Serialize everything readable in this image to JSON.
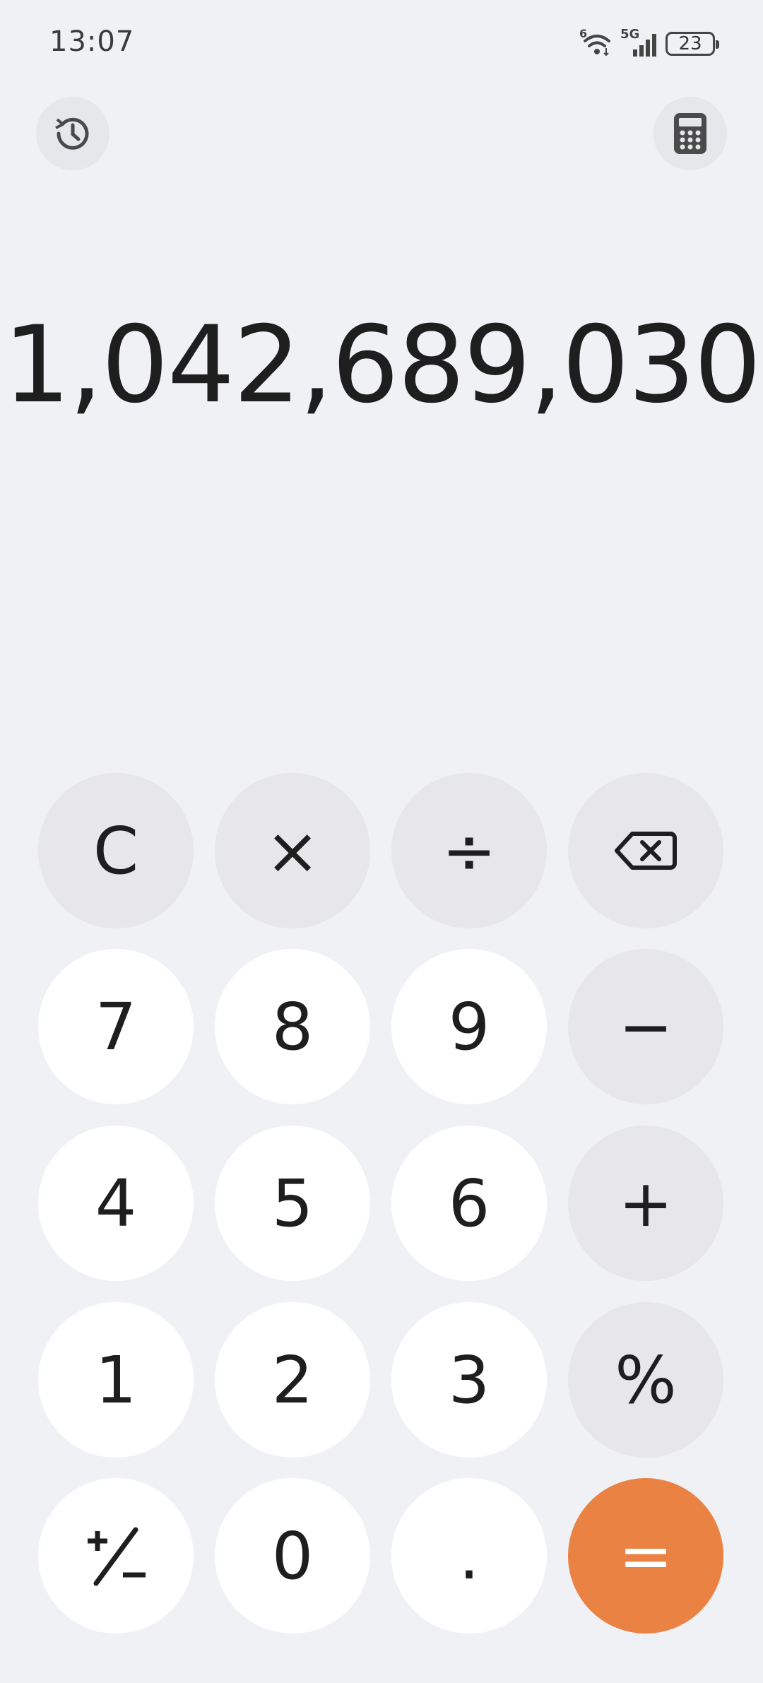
{
  "status": {
    "time": "13:07",
    "battery": "23",
    "network": "5G",
    "wifi_badge": "6"
  },
  "toolbar": {
    "history_icon": "history-icon",
    "calculator_icon": "calculator-icon"
  },
  "display": {
    "value": "1,042,689,030"
  },
  "keypad": {
    "clear": "C",
    "multiply": "×",
    "divide": "÷",
    "backspace_icon": "backspace-icon",
    "seven": "7",
    "eight": "8",
    "nine": "9",
    "minus": "−",
    "four": "4",
    "five": "5",
    "six": "6",
    "plus": "+",
    "one": "1",
    "two": "2",
    "three": "3",
    "percent": "%",
    "plus_minus_icon": "plus-minus-icon",
    "zero": "0",
    "decimal": ".",
    "equals": "="
  },
  "colors": {
    "background": "#f0f1f5",
    "key_white": "#ffffff",
    "key_gray": "#e7e7e9",
    "equals": "#ea8244",
    "text": "#1e1e1e"
  }
}
